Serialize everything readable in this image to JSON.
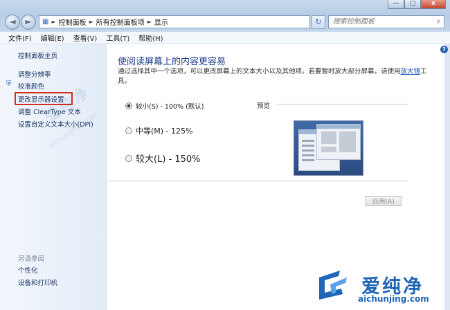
{
  "window": {
    "caption": {
      "minimize": "—",
      "maximize": "▢",
      "close": "x"
    }
  },
  "address_bar": {
    "crumbs": [
      "控制面板",
      "所有控制面板项",
      "显示"
    ],
    "search_placeholder": "搜索控制面板"
  },
  "menu": [
    "文件(F)",
    "编辑(E)",
    "查看(V)",
    "工具(T)",
    "帮助(H)"
  ],
  "sidebar": {
    "items": [
      "控制面板主页",
      "调整分辨率",
      "校准颜色",
      "更改显示器设置",
      "调整 ClearType 文本",
      "设置自定义文本大小(DPI)"
    ],
    "see_also_title": "另请参阅",
    "see_also": [
      "个性化",
      "设备和打印机"
    ]
  },
  "main": {
    "title": "使阅读屏幕上的内容更容易",
    "description": "通过选择其中一个选项，可以更改屏幕上的文本大小以及其他项。若要暂时放大部分屏幕，请使用",
    "description_link": "放大镜",
    "description_tail": "工具。",
    "options": [
      {
        "label": "较小(S) - 100% (默认)",
        "selected": true
      },
      {
        "label": "中等(M) - 125%",
        "selected": false
      },
      {
        "label": "较大(L) - 150%",
        "selected": false
      }
    ],
    "preview_label": "预览",
    "apply_button": "应用(A)"
  },
  "watermark": {
    "title": "爱纯净",
    "subtitle": "aichunjing.com",
    "diag_title": "爱纯净",
    "diag_url": "aichunjing.com"
  },
  "colors": {
    "link": "#1a3566",
    "title": "#1d3f8a",
    "highlight_border": "#d42b20",
    "watermark": "#1f66b8"
  }
}
